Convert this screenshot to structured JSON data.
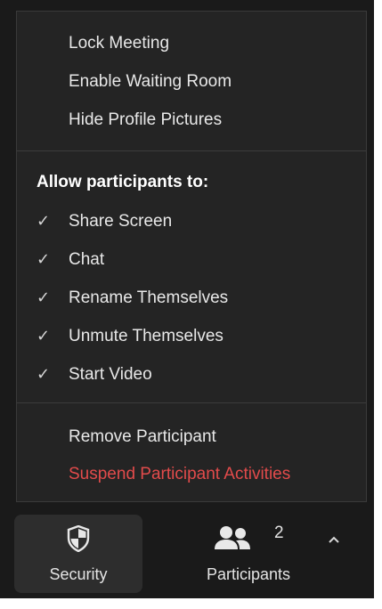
{
  "menu": {
    "top_items": [
      {
        "label": "Lock Meeting"
      },
      {
        "label": "Enable Waiting Room"
      },
      {
        "label": "Hide Profile Pictures"
      }
    ],
    "allow_heading": "Allow participants to:",
    "allow_items": [
      {
        "label": "Share Screen",
        "checked": true
      },
      {
        "label": "Chat",
        "checked": true
      },
      {
        "label": "Rename Themselves",
        "checked": true
      },
      {
        "label": "Unmute Themselves",
        "checked": true
      },
      {
        "label": "Start Video",
        "checked": true
      }
    ],
    "check_glyph": "✓",
    "bottom_items": [
      {
        "label": "Remove Participant"
      },
      {
        "label": "Suspend Participant Activities"
      }
    ]
  },
  "toolbar": {
    "security": {
      "label": "Security",
      "icon": "shield-icon"
    },
    "participants": {
      "label": "Participants",
      "count": "2",
      "icon": "participants-icon"
    },
    "caret": {
      "icon": "chevron-up-icon"
    }
  },
  "colors": {
    "background": "#1a1a1a",
    "menu": "#242424",
    "text": "#e8e8e8",
    "danger": "#e24b4b"
  }
}
